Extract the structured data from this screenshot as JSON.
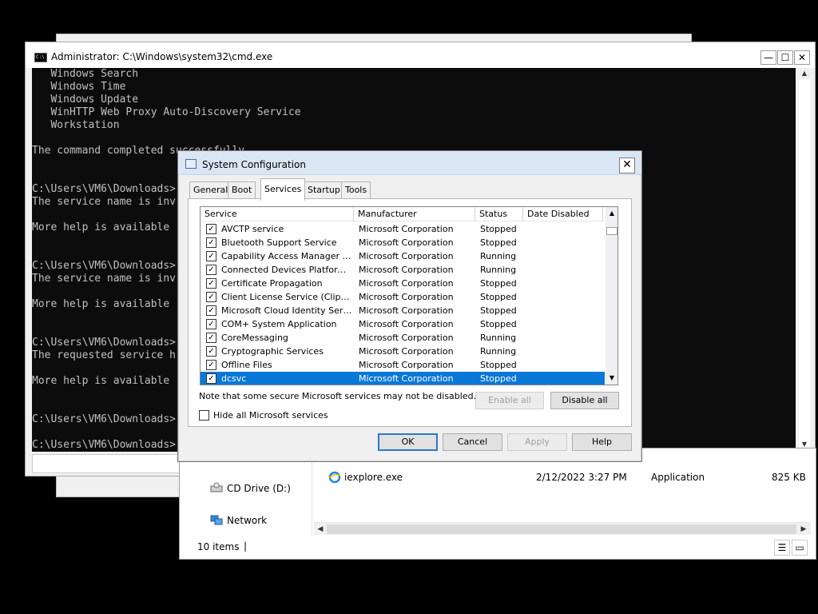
{
  "colors": {
    "selection": "#0a78d7",
    "console_bg": "#0c0c0c",
    "console_text": "#c0c0c0"
  },
  "cmd": {
    "title": "Administrator: C:\\Windows\\system32\\cmd.exe",
    "icon_text": "C:\\",
    "controls": {
      "minimize": "—",
      "maximize": "☐",
      "close": "✕"
    },
    "lines": [
      "   Windows Search",
      "   Windows Time",
      "   Windows Update",
      "   WinHTTP Web Proxy Auto-Discovery Service",
      "   Workstation",
      "",
      "The command completed successfully.",
      "",
      "",
      "C:\\Users\\VM6\\Downloads>",
      "The service name is inv",
      "",
      "More help is available",
      "",
      "",
      "C:\\Users\\VM6\\Downloads>",
      "The service name is inv",
      "",
      "More help is available",
      "",
      "",
      "C:\\Users\\VM6\\Downloads>",
      "The requested service h",
      "",
      "More help is available",
      "",
      "",
      "C:\\Users\\VM6\\Downloads>",
      "",
      "C:\\Users\\VM6\\Downloads>"
    ]
  },
  "explorer": {
    "nav": [
      {
        "label": "CD Drive (D:)",
        "icon": "cd-drive-icon"
      },
      {
        "label": "Network",
        "icon": "network-icon"
      }
    ],
    "file": {
      "name": "iexplore.exe",
      "date": "2/12/2022 3:27 PM",
      "type": "Application",
      "size": "825 KB"
    },
    "status": "10 items",
    "status_caret": "|"
  },
  "dialog": {
    "title": "System Configuration",
    "close": "✕",
    "tabs": [
      "General",
      "Boot",
      "Services",
      "Startup",
      "Tools"
    ],
    "active_tab": "Services",
    "columns": [
      "Service",
      "Manufacturer",
      "Status",
      "Date Disabled"
    ],
    "sort_arrow": "▲",
    "rows": [
      {
        "service": "AVCTP service",
        "manufacturer": "Microsoft Corporation",
        "status": "Stopped",
        "checked": true
      },
      {
        "service": "Bluetooth Support Service",
        "manufacturer": "Microsoft Corporation",
        "status": "Stopped",
        "checked": true
      },
      {
        "service": "Capability Access Manager Servi...",
        "manufacturer": "Microsoft Corporation",
        "status": "Running",
        "checked": true
      },
      {
        "service": "Connected Devices Platform Se...",
        "manufacturer": "Microsoft Corporation",
        "status": "Running",
        "checked": true
      },
      {
        "service": "Certificate Propagation",
        "manufacturer": "Microsoft Corporation",
        "status": "Stopped",
        "checked": true
      },
      {
        "service": "Client License Service (ClipSVC)",
        "manufacturer": "Microsoft Corporation",
        "status": "Stopped",
        "checked": true
      },
      {
        "service": "Microsoft Cloud Identity Service",
        "manufacturer": "Microsoft Corporation",
        "status": "Stopped",
        "checked": true
      },
      {
        "service": "COM+ System Application",
        "manufacturer": "Microsoft Corporation",
        "status": "Stopped",
        "checked": true
      },
      {
        "service": "CoreMessaging",
        "manufacturer": "Microsoft Corporation",
        "status": "Running",
        "checked": true
      },
      {
        "service": "Cryptographic Services",
        "manufacturer": "Microsoft Corporation",
        "status": "Running",
        "checked": true
      },
      {
        "service": "Offline Files",
        "manufacturer": "Microsoft Corporation",
        "status": "Stopped",
        "checked": true
      },
      {
        "service": "dcsvc",
        "manufacturer": "Microsoft Corporation",
        "status": "Stopped",
        "checked": true,
        "selected": true
      }
    ],
    "note": "Note that some secure Microsoft services may not be disabled.",
    "enable_all": "Enable all",
    "disable_all": "Disable all",
    "hide_ms": "Hide all Microsoft services",
    "check_mark": "✓",
    "buttons": {
      "ok": "OK",
      "cancel": "Cancel",
      "apply": "Apply",
      "help": "Help"
    }
  }
}
